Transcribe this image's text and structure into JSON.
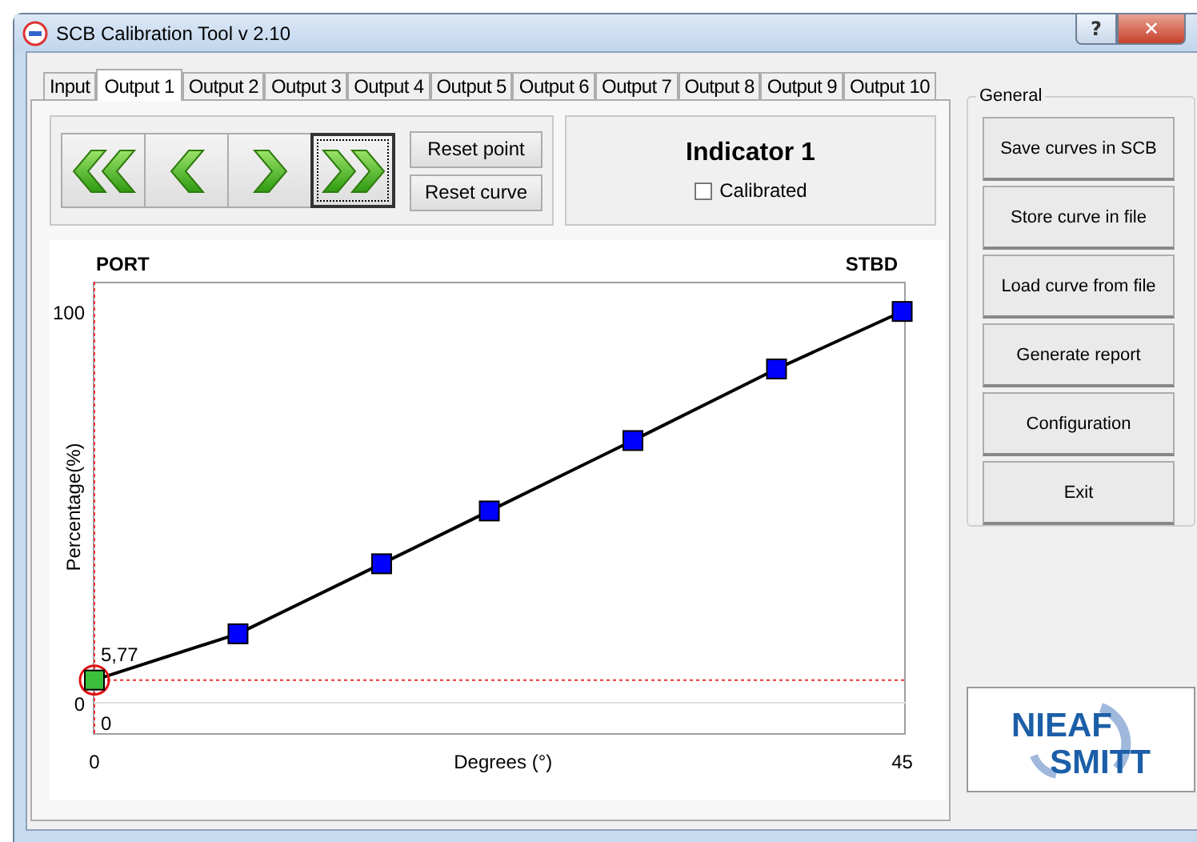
{
  "window": {
    "title": "SCB Calibration Tool v 2.10",
    "help_button": "?",
    "close_button": "✕"
  },
  "tabs": [
    {
      "label": "Input",
      "selected": false
    },
    {
      "label": "Output 1",
      "selected": true
    },
    {
      "label": "Output 2",
      "selected": false
    },
    {
      "label": "Output 3",
      "selected": false
    },
    {
      "label": "Output 4",
      "selected": false
    },
    {
      "label": "Output 5",
      "selected": false
    },
    {
      "label": "Output 6",
      "selected": false
    },
    {
      "label": "Output 7",
      "selected": false
    },
    {
      "label": "Output 8",
      "selected": false
    },
    {
      "label": "Output 9",
      "selected": false
    },
    {
      "label": "Output 10",
      "selected": false
    }
  ],
  "navigation": {
    "buttons": [
      {
        "kind": "first",
        "focused": false
      },
      {
        "kind": "previous",
        "focused": false
      },
      {
        "kind": "next",
        "focused": false
      },
      {
        "kind": "last",
        "focused": true
      }
    ],
    "reset_buttons": [
      "Reset point",
      "Reset curve"
    ]
  },
  "indicator": {
    "title": "Indicator 1",
    "checkbox": {
      "label": "Calibrated",
      "checked": false
    }
  },
  "chart": {
    "left_label": "PORT",
    "right_label": "STBD",
    "points": [
      {
        "selected": true
      },
      {
        "selected": false
      },
      {
        "selected": false
      },
      {
        "selected": false
      },
      {
        "selected": false
      },
      {
        "selected": false
      },
      {
        "selected": false
      }
    ],
    "chart_data": {
      "type": "line",
      "xlabel": "Degrees (°)",
      "ylabel": "Percentage(%)",
      "x": [
        0,
        8,
        16,
        22,
        30,
        38,
        45
      ],
      "series": [
        {
          "color": "#000000",
          "marker": "square",
          "values": [
            5.77,
            17.6,
            35.5,
            49,
            67,
            85.3,
            100
          ]
        }
      ],
      "ref_lines": [
        {
          "axis": "x",
          "value": 0,
          "color": "#f03030"
        },
        {
          "axis": "y",
          "value": 5.77,
          "color": "#f03030"
        }
      ],
      "xlim": [
        0,
        45.2
      ],
      "ylim": [
        -7.8,
        107.6
      ],
      "xticks": [
        0,
        45
      ],
      "yticks": [
        0,
        100
      ],
      "annotations": [
        "5,77",
        "0"
      ]
    }
  },
  "general": {
    "title": "General",
    "buttons": [
      "Save curves in SCB",
      "Store curve in file",
      "Load curve from file",
      "Generate report",
      "Configuration",
      "Exit"
    ]
  },
  "logo": {
    "line_1": "NIEAF",
    "line_2": "SMITT"
  }
}
